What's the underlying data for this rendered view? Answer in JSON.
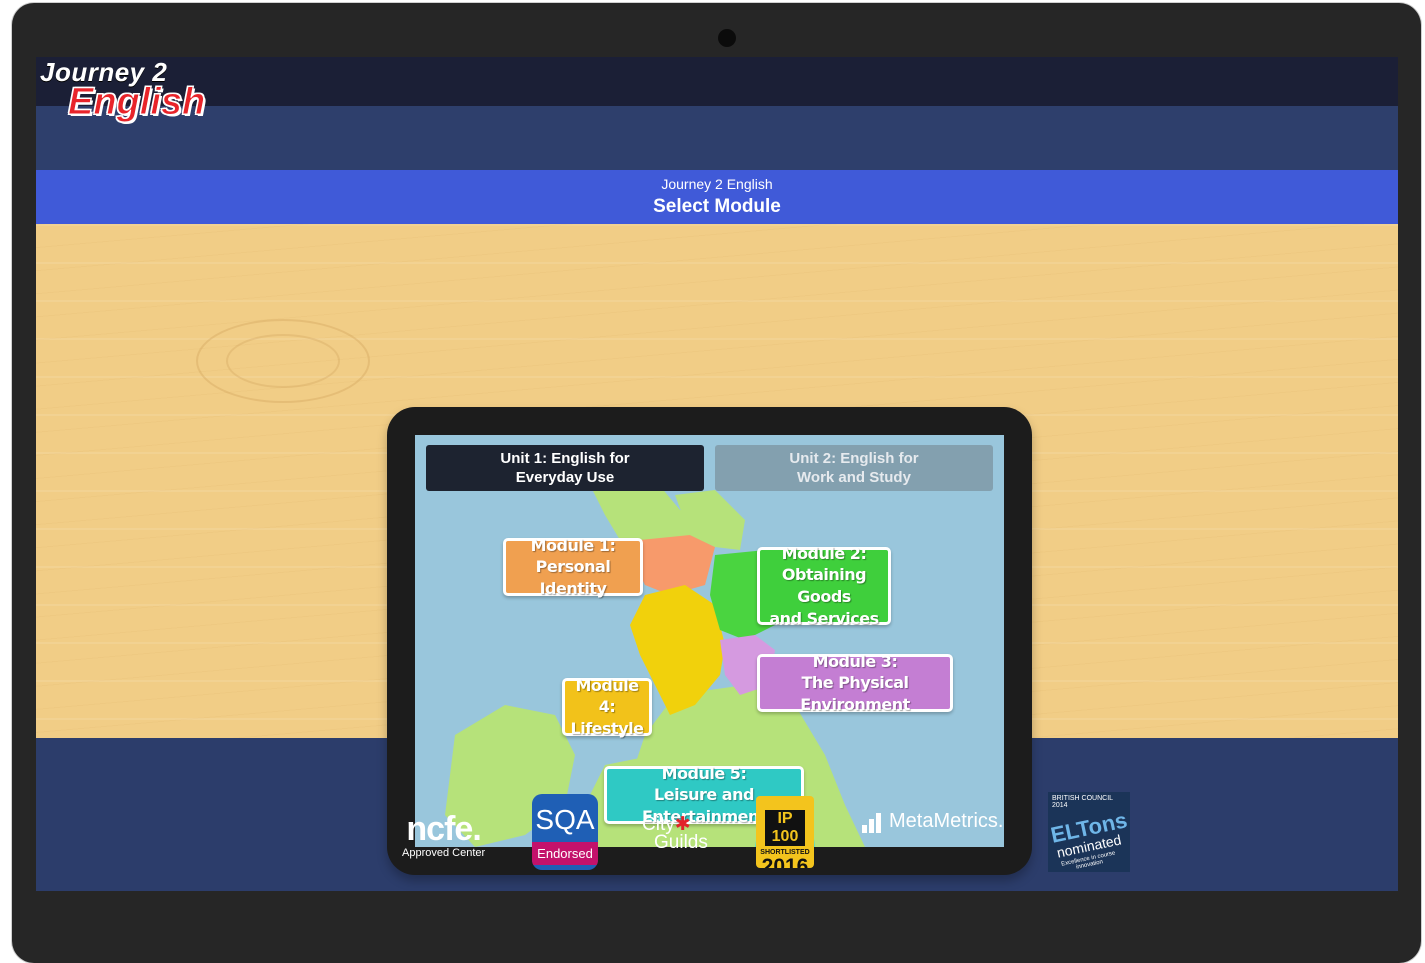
{
  "header": {
    "logo_line1": "Journey 2",
    "logo_line2": "English"
  },
  "title_bar": {
    "subtitle": "Journey 2 English",
    "title": "Select Module"
  },
  "units": [
    {
      "label": "Unit 1: English for Everyday Use",
      "line1": "Unit 1: English for",
      "line2": "Everyday Use",
      "active": true
    },
    {
      "label": "Unit 2: English for Work and Study",
      "line1": "Unit 2: English for",
      "line2": "Work and Study",
      "active": false
    }
  ],
  "modules": [
    {
      "line1": "Module 1:",
      "line2": "Personal Identity",
      "line3": "",
      "color": "#f0a050"
    },
    {
      "line1": "Module 2:",
      "line2": "Obtaining Goods",
      "line3": "and Services",
      "color": "#3fcf3c"
    },
    {
      "line1": "Module 3:",
      "line2": "The Physical Environment",
      "line3": "",
      "color": "#c47ed3"
    },
    {
      "line1": "Module 4:",
      "line2": "Lifestyle",
      "line3": "",
      "color": "#f2c21a"
    },
    {
      "line1": "Module 5:",
      "line2": "Leisure and Entertainment",
      "line3": "",
      "color": "#2fc9c4"
    }
  ],
  "footer_logos": {
    "ncfe": {
      "name": "ncfe.",
      "tag": "Approved Center"
    },
    "sqa": {
      "name": "SQA",
      "tag": "Endorsed"
    },
    "city_guilds": {
      "line1": "City",
      "line2": "Guilds"
    },
    "ip100": {
      "name": "IP 100",
      "tag": "SHORTLISTED",
      "year": "2016"
    },
    "metametrics": {
      "name": "MetaMetrics."
    },
    "eltons": {
      "header": "BRITISH COUNCIL 2014",
      "name": "ELTons",
      "tag": "nominated",
      "sub": "Excellence in course innovation"
    }
  },
  "colors": {
    "title_bar": "#405ad8",
    "top_bar": "#1b1f36",
    "footer": "#2c3d6b",
    "wood": "#f1cd86",
    "map_water": "#99c6dc"
  }
}
